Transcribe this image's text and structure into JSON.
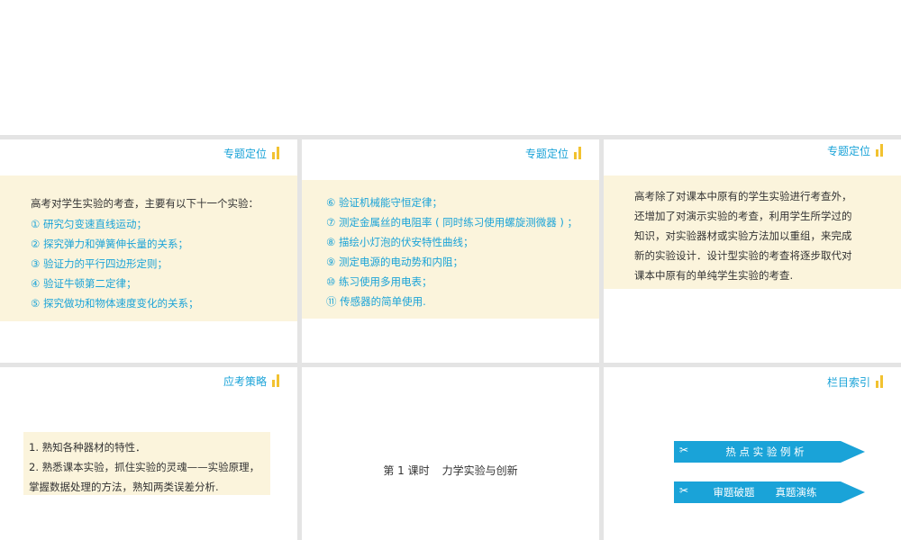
{
  "panel1": {
    "header": "专题定位",
    "intro": "高考对学生实验的考查，主要有以下十一个实验：",
    "items": [
      "① 研究匀变速直线运动；",
      "② 探究弹力和弹簧伸长量的关系；",
      "③ 验证力的平行四边形定则；",
      "④ 验证牛顿第二定律；",
      "⑤ 探究做功和物体速度变化的关系；"
    ]
  },
  "panel2": {
    "header": "专题定位",
    "items": [
      "⑥ 验证机械能守恒定律；",
      "⑦ 测定金属丝的电阻率 ( 同时练习使用螺旋测微器 ) ；",
      "⑧ 描绘小灯泡的伏安特性曲线；",
      "⑨ 测定电源的电动势和内阻；",
      "⑩ 练习使用多用电表；",
      "⑪ 传感器的简单使用."
    ]
  },
  "panel3": {
    "header": "专题定位",
    "lines": [
      "高考除了对课本中原有的学生实验进行考查外，",
      "还增加了对演示实验的考查，利用学生所学过的",
      "知识，对实验器材或实验方法加以重组，来完成",
      "新的实验设计．设计型实验的考查将逐步取代对",
      "课本中原有的单纯学生实验的考查."
    ]
  },
  "panel4": {
    "header": "应考策略",
    "lines": [
      "1. 熟知各种器材的特性．",
      "2. 熟悉课本实验，抓住实验的灵魂——实验原理，",
      "掌握数据处理的方法，熟知两类误差分析."
    ]
  },
  "panel5": {
    "lesson": "第 1 课时",
    "topic": "力学实验与创新"
  },
  "panel6": {
    "header": "栏目索引",
    "buttons": [
      {
        "icon": "✂",
        "label": "热 点 实 验 例 析"
      },
      {
        "icon": "✂",
        "label": "审题破题　　真题演练"
      }
    ]
  },
  "colors": {
    "accent": "#1aa3d8",
    "highlight_bg": "#fbf4dc",
    "bars": "#f2c230"
  }
}
